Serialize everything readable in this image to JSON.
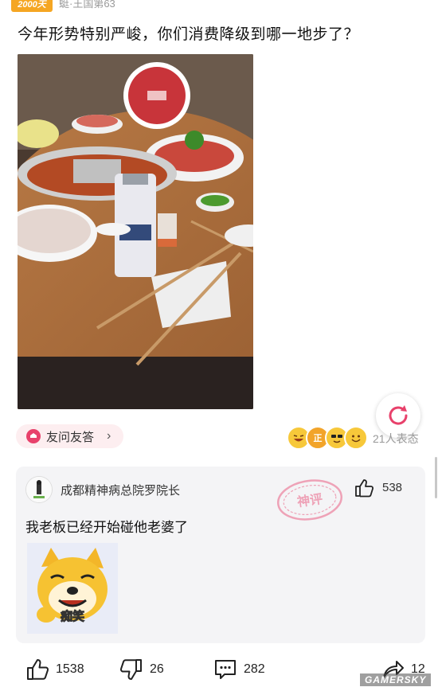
{
  "header": {
    "badge": "2000天",
    "meta": "蜓·王国第63"
  },
  "post": {
    "title": "今年形势特别严峻，你们消费降级到哪一地步了？"
  },
  "qa": {
    "label": "友问友答",
    "chevron": "›"
  },
  "reactions": {
    "count_label": "21人表态",
    "emojis": [
      "laugh-emoji",
      "zheng-emoji",
      "cool-emoji",
      "grin-emoji"
    ]
  },
  "hot_comment": {
    "author": "成都精神病总院罗院长",
    "likes": "538",
    "text": "我老板已经开始碰他老婆了",
    "stamp": "神评",
    "sticker_caption": "痴笑"
  },
  "actions": {
    "like_count": "1538",
    "dislike_count": "26",
    "comment_count": "282",
    "share_count": "12"
  },
  "watermark": "GAMERSKY",
  "colors": {
    "accent": "#e8416b",
    "card_bg": "#f4f4f6",
    "pill_bg": "#fdeef0"
  }
}
